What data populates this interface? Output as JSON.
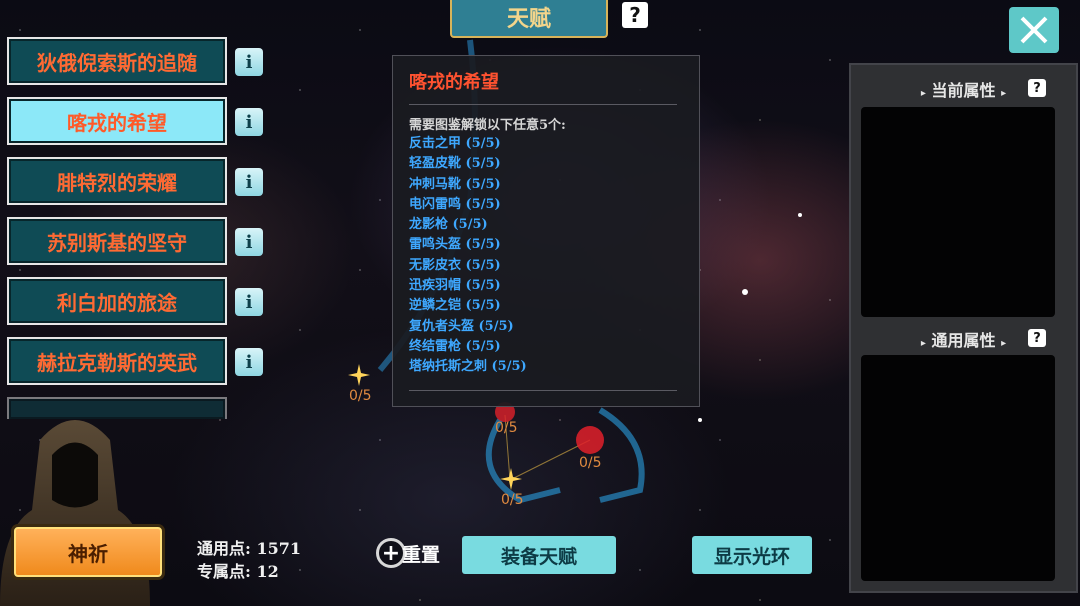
{
  "header": {
    "title": "天赋"
  },
  "talents": [
    {
      "label": "狄俄倪索斯的追随",
      "active": false
    },
    {
      "label": "喀戎的希望",
      "active": true
    },
    {
      "label": "腓特烈的荣耀",
      "active": false
    },
    {
      "label": "苏别斯基的坚守",
      "active": false
    },
    {
      "label": "利白加的旅途",
      "active": false
    },
    {
      "label": "赫拉克勒斯的英武",
      "active": false
    }
  ],
  "popup": {
    "title": "喀戎的希望",
    "requirement": "需要图鉴解锁以下任意5个:",
    "items": [
      "反击之甲 (5/5)",
      "轻盈皮靴 (5/5)",
      "冲刺马靴 (5/5)",
      "电闪雷鸣 (5/5)",
      "龙影枪 (5/5)",
      "雷鸣头盔 (5/5)",
      "无影皮衣 (5/5)",
      "迅疾羽帽 (5/5)",
      "逆鳞之铠 (5/5)",
      "复仇者头盔 (5/5)",
      "终结雷枪 (5/5)",
      "塔纳托斯之刺 (5/5)"
    ]
  },
  "nodes": [
    "0/5",
    "0/5",
    "0/5",
    "0/5"
  ],
  "right_panel": {
    "current_attr": "当前属性",
    "general_attr": "通用属性"
  },
  "bottom": {
    "pray": "神祈",
    "general_points_label": "通用点:",
    "general_points": "1571",
    "exclusive_points_label": "专属点:",
    "exclusive_points": "12",
    "reset": "重置",
    "equip": "装备天赋",
    "show_halo": "显示光环"
  },
  "colors": {
    "teal": "#79dbe0",
    "accent_orange": "#ff5a28",
    "link_blue": "#3ea8ff",
    "pray_orange": "#f08a1c"
  },
  "icons": [
    "info-icon",
    "question-icon",
    "close-icon",
    "plus-icon",
    "arrow-icon",
    "star-node-icon"
  ]
}
